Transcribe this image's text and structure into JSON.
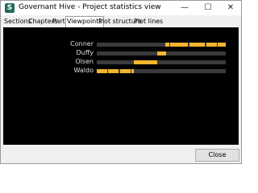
{
  "window": {
    "title": "Governant Hive - Project statistics view",
    "app_icon_glyph": "S"
  },
  "tabs": [
    {
      "label": "Sections"
    },
    {
      "label": "Chapters"
    },
    {
      "label": "Parts"
    },
    {
      "label": "Viewpoints",
      "active": true
    },
    {
      "label": "Plot structure"
    },
    {
      "label": "Plot lines"
    }
  ],
  "controls": {
    "minimize": "—",
    "maximize": "☐",
    "close": "✕"
  },
  "viewpoints": [
    {
      "name": "Conner",
      "segments": [
        [
          0.53,
          0.56
        ],
        [
          0.57,
          0.71
        ],
        [
          0.72,
          0.84
        ],
        [
          0.85,
          0.93
        ],
        [
          0.94,
          1.0
        ]
      ]
    },
    {
      "name": "Duffy",
      "segments": [
        [
          0.47,
          0.54
        ]
      ]
    },
    {
      "name": "Olsen",
      "segments": [
        [
          0.29,
          0.47
        ]
      ]
    },
    {
      "name": "Waldo",
      "segments": [
        [
          0.0,
          0.08
        ],
        [
          0.09,
          0.17
        ],
        [
          0.18,
          0.26
        ],
        [
          0.27,
          0.29
        ]
      ]
    }
  ],
  "colors": {
    "segment": "#f2b531",
    "track": "#3a3a3a",
    "panel": "#000000"
  },
  "footer": {
    "close_label": "Close"
  }
}
